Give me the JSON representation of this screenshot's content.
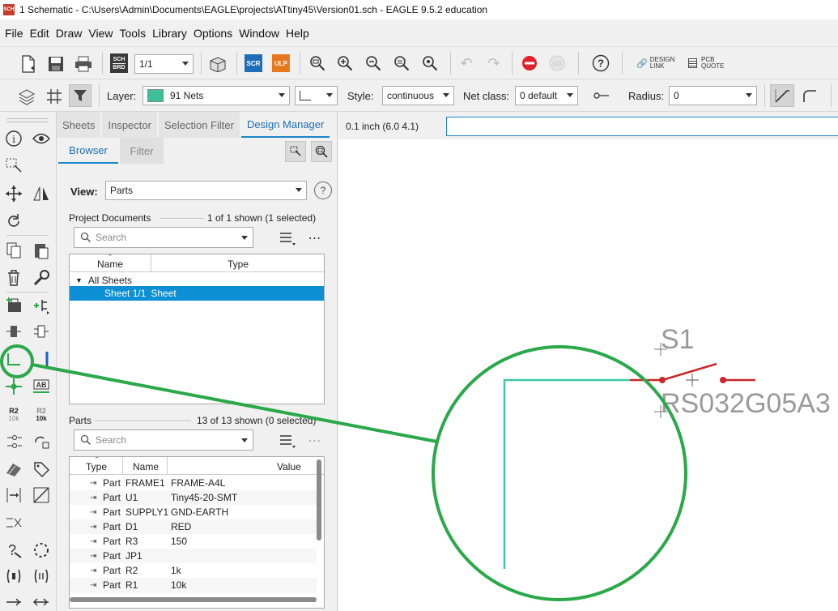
{
  "window": {
    "title": "1 Schematic - C:\\Users\\Admin\\Documents\\EAGLE\\projects\\ATtiny45\\Version01.sch - EAGLE 9.5.2 education",
    "app_icon_text": "SCH"
  },
  "menu": [
    "File",
    "Edit",
    "Draw",
    "View",
    "Tools",
    "Library",
    "Options",
    "Window",
    "Help"
  ],
  "toolbar": {
    "sheet_value": "1/1",
    "scr_label": "SCR",
    "ulp_label": "ULP",
    "design_link": [
      "DESIGN",
      "LINK"
    ],
    "pcb_quote": [
      "PCB",
      "QUOTE"
    ],
    "sch_brd": [
      "SCH",
      "BRD"
    ]
  },
  "properties": {
    "layer_label": "Layer:",
    "layer_value": "91 Nets",
    "layer_color": "#3cbf9a",
    "style_label": "Style:",
    "style_value": "continuous",
    "netclass_label": "Net class:",
    "netclass_value": "0 default",
    "radius_label": "Radius:",
    "radius_value": "0"
  },
  "tools": {
    "r2_label": "R2",
    "r2_value": "10k",
    "ab_label": "AB"
  },
  "panel": {
    "tabs": [
      "Sheets",
      "Inspector",
      "Selection Filter",
      "Design Manager"
    ],
    "subtabs": [
      "Browser",
      "Filter"
    ],
    "view_label": "View:",
    "view_value": "Parts",
    "help_symbol": "?",
    "project_docs": {
      "title": "Project Documents",
      "count": "1 of 1 shown (1 selected)",
      "search_placeholder": "Search",
      "col_name": "Name",
      "col_type": "Type",
      "group": "All Sheets",
      "selected_name": "Sheet 1/1",
      "selected_type": "Sheet"
    },
    "parts": {
      "title": "Parts",
      "count": "13 of 13 shown (0 selected)",
      "search_placeholder": "Search",
      "col_type": "Type",
      "col_name": "Name",
      "col_value": "Value",
      "rows": [
        {
          "type": "Part",
          "name": "FRAME1",
          "value": "FRAME-A4L"
        },
        {
          "type": "Part",
          "name": "U1",
          "value": "Tiny45-20-SMT"
        },
        {
          "type": "Part",
          "name": "SUPPLY1",
          "value": "GND-EARTH"
        },
        {
          "type": "Part",
          "name": "D1",
          "value": "RED"
        },
        {
          "type": "Part",
          "name": "R3",
          "value": "150"
        },
        {
          "type": "Part",
          "name": "JP1",
          "value": ""
        },
        {
          "type": "Part",
          "name": "R2",
          "value": "1k"
        },
        {
          "type": "Part",
          "name": "R1",
          "value": "10k"
        }
      ]
    }
  },
  "canvas": {
    "coordinate": "0.1 inch (6.0 4.1)",
    "part_name": "S1",
    "part_value": "RS032G05A3"
  },
  "colors": {
    "net": "#3cc8a8",
    "symbol": "#c8282a",
    "annotation": "#2aa84a",
    "selection": "#0d8fd6"
  }
}
